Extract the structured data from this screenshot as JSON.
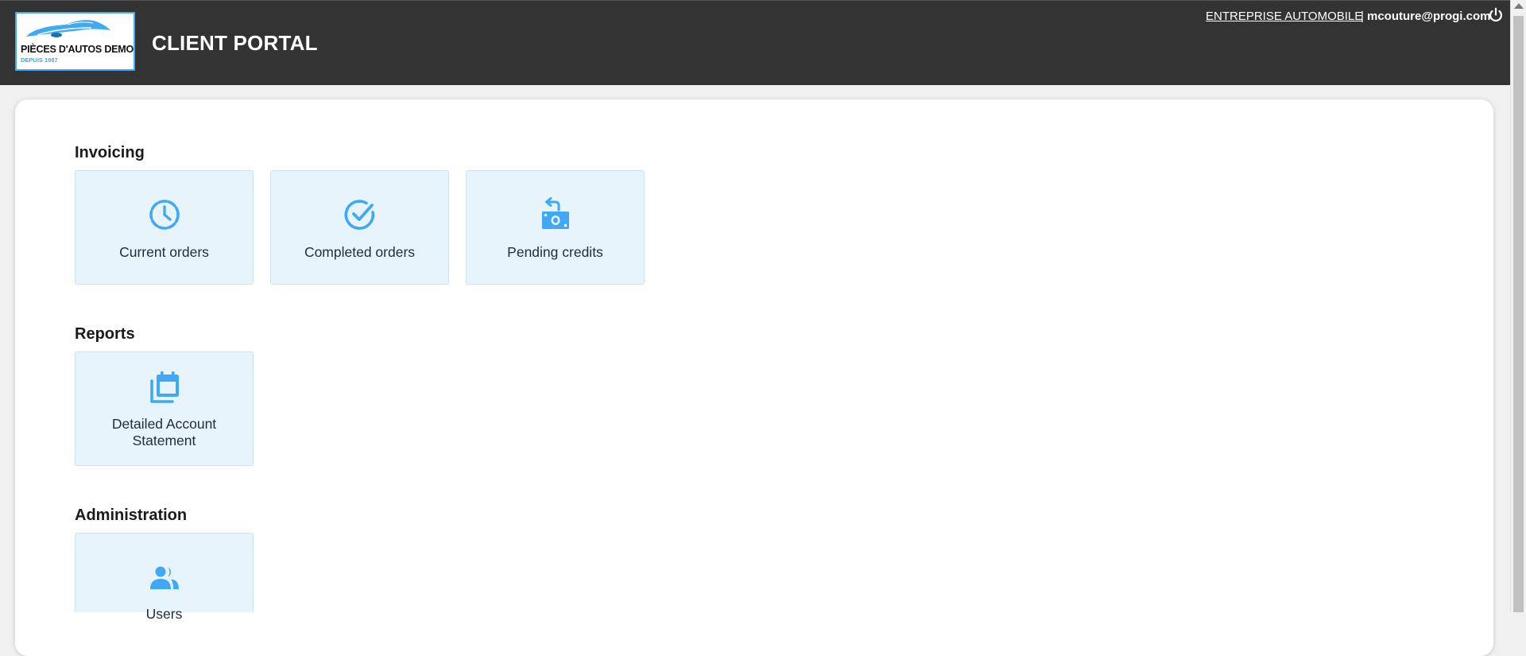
{
  "header": {
    "logo_name": "PIÈCES D'AUTOS DEMO",
    "logo_tagline": "DEPUIS 1987",
    "app_title": "CLIENT PORTAL",
    "company": "ENTREPRISE AUTOMOBILE",
    "separator": "|",
    "user_email": "mcouture@progi.com",
    "power_icon": "power-icon"
  },
  "sections": {
    "invoicing": {
      "title": "Invoicing",
      "tiles": [
        {
          "label": "Current orders",
          "icon": "clock-icon"
        },
        {
          "label": "Completed orders",
          "icon": "check-circle-icon"
        },
        {
          "label": "Pending credits",
          "icon": "money-return-icon"
        }
      ]
    },
    "reports": {
      "title": "Reports",
      "tiles": [
        {
          "label": "Detailed Account Statement",
          "icon": "calendar-stack-icon"
        }
      ]
    },
    "administration": {
      "title": "Administration",
      "tiles": [
        {
          "label": "Users",
          "icon": "users-icon"
        }
      ]
    }
  },
  "colors": {
    "header_bg": "#333333",
    "accent": "#3fa9f5",
    "tile_bg": "#e8f4fc",
    "page_bg": "#f0f0f0"
  }
}
